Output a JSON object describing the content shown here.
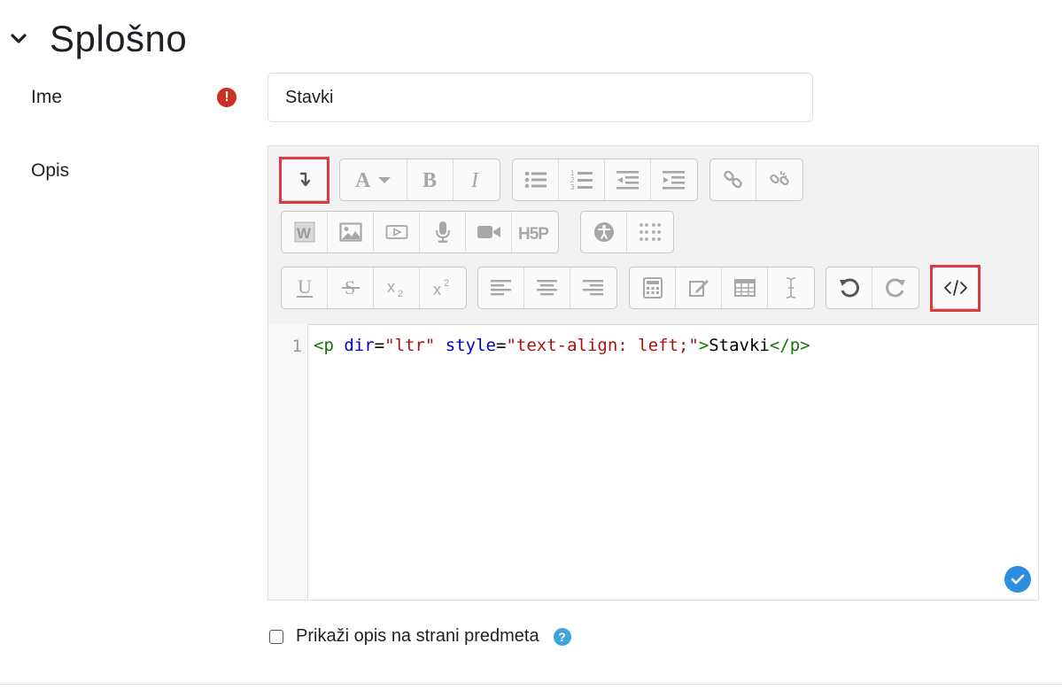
{
  "section": {
    "title": "Splošno",
    "chevron_icon": "chevron-down-icon"
  },
  "fields": {
    "name": {
      "label": "Ime",
      "value": "Stavki",
      "required_icon": "exclamation-circle-icon",
      "required_color": "#ca3120"
    },
    "description": {
      "label": "Opis"
    }
  },
  "editor": {
    "toolbar_rows": [
      [
        [
          "toolbar-toggle"
        ],
        [
          "font-style",
          "bold",
          "italic"
        ],
        [
          "unordered-list",
          "ordered-list",
          "outdent",
          "indent"
        ],
        [
          "link",
          "unlink"
        ]
      ],
      [
        [
          "word-import",
          "image",
          "media",
          "audio-record",
          "video-record",
          "h5p"
        ],
        [
          "accessibility-checker",
          "screenreader-helper"
        ]
      ],
      [
        [
          "underline",
          "strikethrough",
          "subscript",
          "superscript"
        ],
        [
          "align-left",
          "align-center",
          "align-right"
        ],
        [
          "equation",
          "edit",
          "table",
          "special-char"
        ],
        [
          "undo",
          "redo"
        ],
        [
          "html-source"
        ]
      ]
    ],
    "highlighted_buttons": [
      "toolbar-toggle",
      "html-source"
    ],
    "highlight_color": "#e0393e",
    "line_number": "1",
    "code": {
      "tag_open": "<p",
      "attr1": "dir",
      "eq1": "=",
      "val1": "\"ltr\"",
      "attr2": "style",
      "eq2": "=",
      "val2": "\"text-align: left;\"",
      "close_bracket": ">",
      "text": "Stavki",
      "tag_close": "</p>"
    },
    "status_icon": "check-circle-icon",
    "status_color": "#2d8ee0"
  },
  "show_description": {
    "label": "Prikaži opis na strani predmeta",
    "checked": false,
    "help_icon": "question-circle-icon",
    "help_color": "#3fa3dc"
  }
}
